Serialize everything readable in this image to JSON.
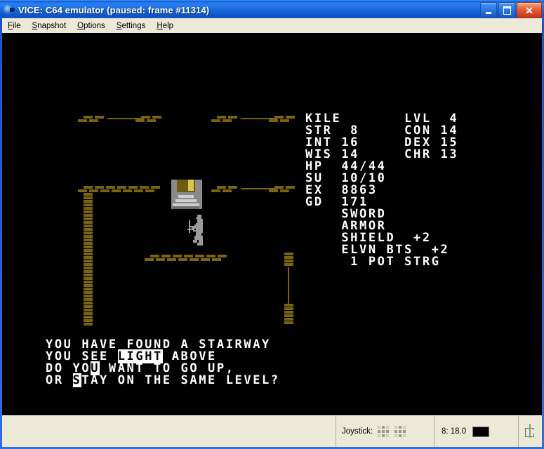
{
  "window": {
    "title": "VICE: C64 emulator (paused: frame #11314)",
    "app_icon": "vice-c64-icon",
    "buttons": {
      "minimize": "minimize-button",
      "maximize": "maximize-button",
      "close": "close-button"
    }
  },
  "menu": {
    "items": [
      {
        "label": "File",
        "mnemonic": "F"
      },
      {
        "label": "Snapshot",
        "mnemonic": "S"
      },
      {
        "label": "Options",
        "mnemonic": "O"
      },
      {
        "label": "Settings",
        "mnemonic": "S"
      },
      {
        "label": "Help",
        "mnemonic": "H"
      }
    ]
  },
  "game": {
    "character": {
      "name": "KILE",
      "level_label": "LVL",
      "level": "4",
      "attributes": [
        {
          "label": "STR",
          "value": "8",
          "label2": "CON",
          "value2": "14"
        },
        {
          "label": "INT",
          "value": "16",
          "label2": "DEX",
          "value2": "15"
        },
        {
          "label": "WIS",
          "value": "14",
          "label2": "CHR",
          "value2": "13"
        }
      ],
      "hp_label": "HP",
      "hp": "44/44",
      "su_label": "SU",
      "su": "10/10",
      "ex_label": "EX",
      "ex": "8863",
      "gd_label": "GD",
      "gd": "171",
      "inventory": [
        "SWORD",
        "ARMOR",
        "SHIELD  +2",
        "ELVN BTS  +2",
        " 1 POT STRG"
      ]
    },
    "stats_lines": [
      "KILE       LVL  4",
      "STR  8     CON 14",
      "INT 16     DEX 15",
      "WIS 14     CHR 13",
      "HP  44/44",
      "SU  10/10",
      "EX  8863",
      "GD  171",
      "    SWORD",
      "    ARMOR",
      "    SHIELD  +2",
      "    ELVN BTS  +2",
      "     1 POT STRG"
    ],
    "messages": [
      {
        "text": "YOU HAVE FOUND A STAIRWAY",
        "highlight": null
      },
      {
        "text": "YOU SEE LIGHT ABOVE",
        "highlight": "LIGHT"
      },
      {
        "text": "DO YOU WANT TO GO UP,",
        "highlight": "U"
      },
      {
        "text": "OR STAY ON THE SAME LEVEL?",
        "highlight": "S"
      }
    ],
    "map": {
      "sprites": [
        {
          "name": "stairway-sprite",
          "description": "stairway up"
        },
        {
          "name": "player-sprite",
          "description": "adventurer with sword"
        }
      ]
    }
  },
  "statusbar": {
    "joystick_label": "Joystick:",
    "drive_label": "8: 18.0",
    "drive_led": "drive-led-off",
    "tape_icon": "tape-counter-icon"
  },
  "colors": {
    "title_blue": "#0a56d4",
    "menu_bg": "#ece9d8",
    "screen_bg": "#000000",
    "wall": "#7a6410",
    "text_white": "#ffffff",
    "sprite_gray": "#8a8a8a",
    "stair_gold": "#8a7014",
    "close_red": "#c8321a"
  }
}
